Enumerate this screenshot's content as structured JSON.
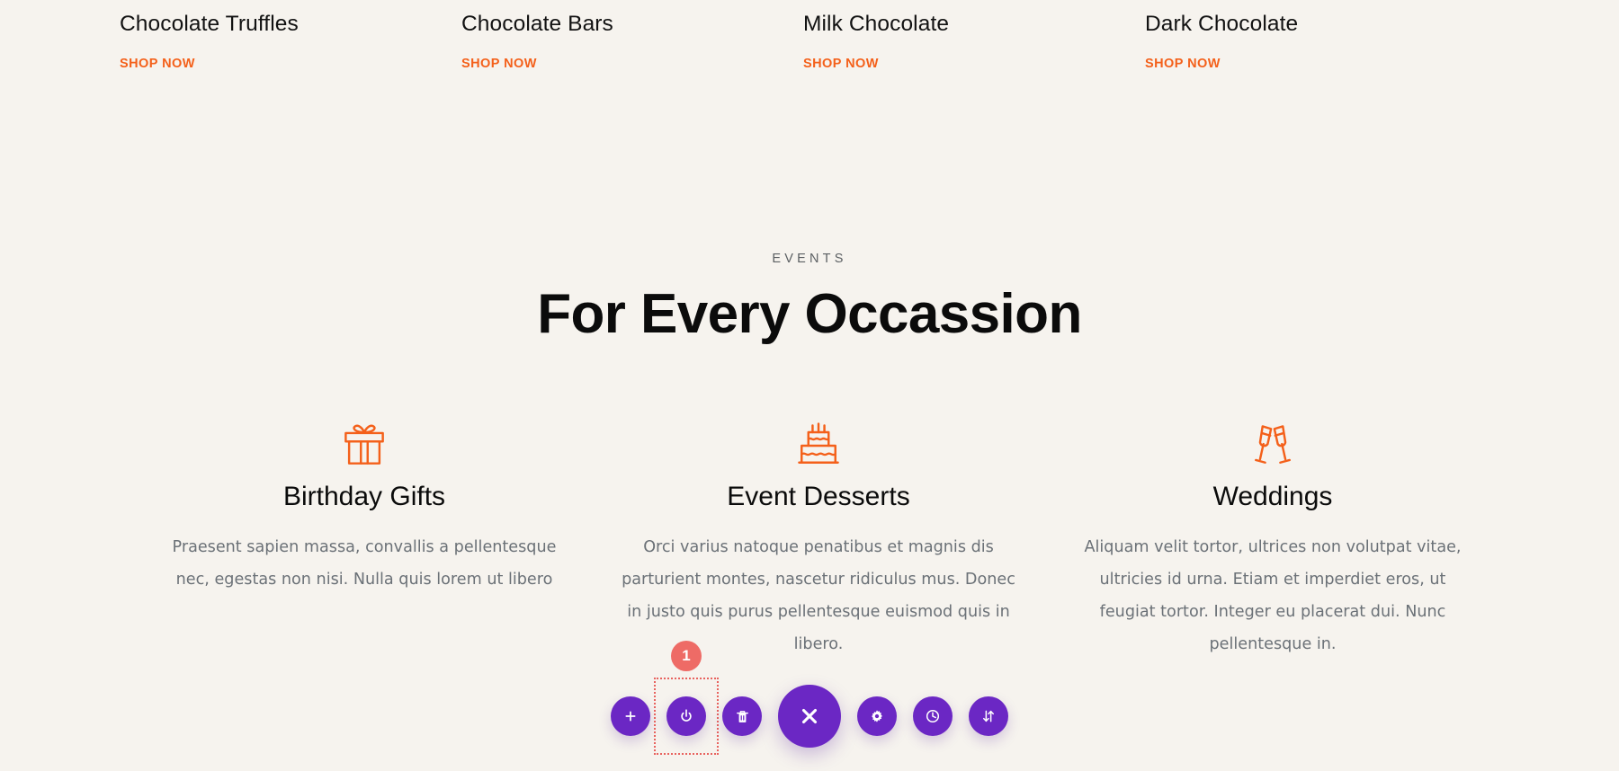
{
  "theme": {
    "background": "#f6f3ee",
    "accent_orange": "#f4601a",
    "heading_color": "#0b0b0b",
    "body_text_color": "#6b7177",
    "toolbar_purple": "#6b27c4",
    "badge_red": "#ee6b66",
    "selection_outline": "#e8635f"
  },
  "products": [
    {
      "title": "Chocolate Truffles",
      "cta": "SHOP NOW"
    },
    {
      "title": "Chocolate Bars",
      "cta": "SHOP NOW"
    },
    {
      "title": "Milk Chocolate",
      "cta": "SHOP NOW"
    },
    {
      "title": "Dark Chocolate",
      "cta": "SHOP NOW"
    }
  ],
  "events": {
    "eyebrow": "EVENTS",
    "heading": "For Every Occassion"
  },
  "features": [
    {
      "icon": "gift-icon",
      "title": "Birthday Gifts",
      "text": "Praesent sapien massa, convallis a pellentesque nec, egestas non nisi. Nulla quis lorem ut libero"
    },
    {
      "icon": "cake-icon",
      "title": "Event Desserts",
      "text": "Orci varius natoque penatibus et magnis dis parturient montes, nascetur ridiculus mus. Donec in justo quis purus pellentesque euismod quis in libero."
    },
    {
      "icon": "champagne-glasses-icon",
      "title": "Weddings",
      "text": "Aliquam velit tortor, ultrices non volutpat vitae, ultricies id urna. Etiam et imperdiet eros, ut feugiat tortor. Integer eu placerat dui. Nunc pellentesque in."
    }
  ],
  "toolbar": {
    "badge": "1",
    "buttons": [
      {
        "name": "add-button",
        "icon": "plus-icon",
        "size": "small",
        "selected": false
      },
      {
        "name": "power-button",
        "icon": "power-icon",
        "size": "small",
        "selected": true
      },
      {
        "name": "delete-button",
        "icon": "trash-icon",
        "size": "small",
        "selected": false
      },
      {
        "name": "close-button",
        "icon": "close-x-icon",
        "size": "large",
        "selected": false
      },
      {
        "name": "settings-button",
        "icon": "gear-icon",
        "size": "small",
        "selected": false
      },
      {
        "name": "history-button",
        "icon": "clock-icon",
        "size": "small",
        "selected": false
      },
      {
        "name": "sort-button",
        "icon": "sort-arrows-icon",
        "size": "small",
        "selected": false
      }
    ]
  }
}
